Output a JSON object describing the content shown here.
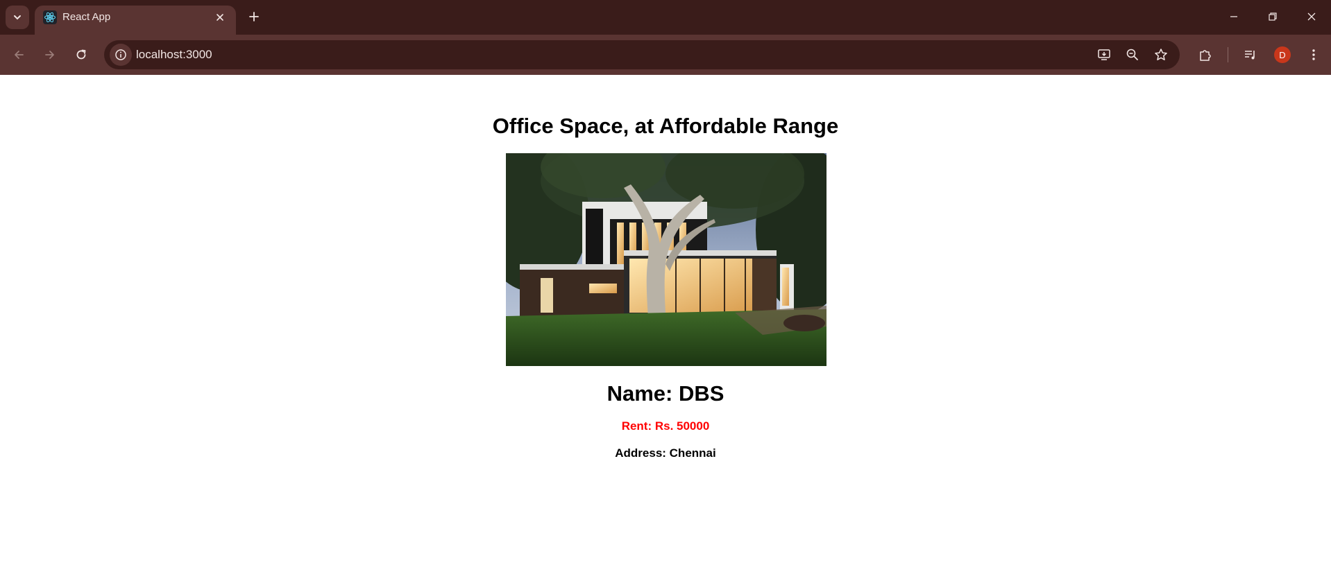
{
  "browser": {
    "tab_title": "React App",
    "url": "localhost:3000",
    "profile_initial": "D",
    "colors": {
      "tabbar_bg": "#3a1c1a",
      "toolbar_bg": "#5a3432",
      "avatar_bg": "#c9371b"
    },
    "icons": {
      "tab_search": "chevron-down-icon",
      "favicon": "react-icon",
      "tab_close": "close-icon",
      "new_tab": "plus-icon",
      "minimize": "minimize-icon",
      "restore": "restore-icon",
      "close_window": "close-icon",
      "back": "arrow-left-icon",
      "forward": "arrow-right-icon",
      "reload": "reload-icon",
      "site_info": "info-icon",
      "install": "install-app-icon",
      "zoom": "zoom-out-icon",
      "bookmark": "star-icon",
      "extensions": "puzzle-icon",
      "media": "media-queue-icon",
      "menu": "more-vertical-icon"
    }
  },
  "page": {
    "title": "Office Space, at Affordable Range",
    "image_subject": "modern house with tree, lit interior at dusk",
    "name": "Name: DBS",
    "rent": "Rent: Rs. 50000",
    "address": "Address: Chennai",
    "colors": {
      "rent": "#ff0000",
      "text": "#000000"
    }
  }
}
